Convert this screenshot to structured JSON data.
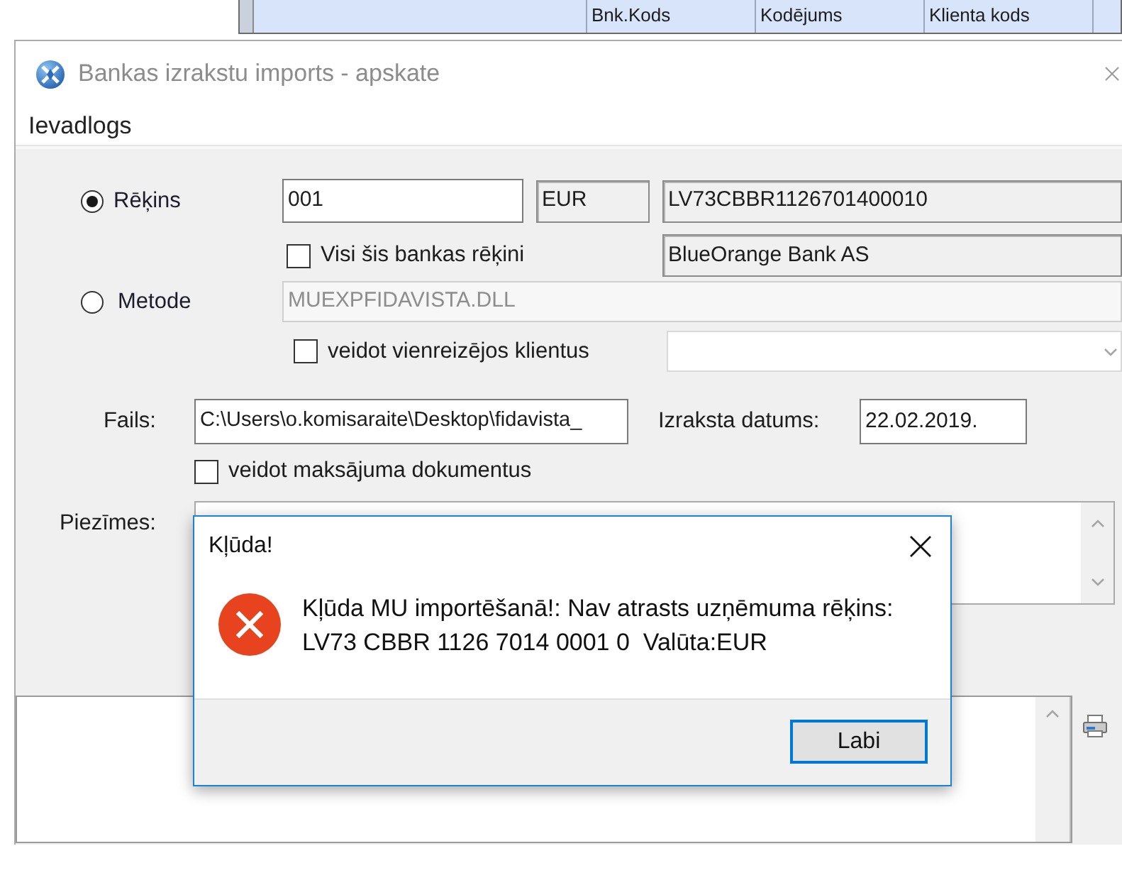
{
  "background_table": {
    "columns": [
      "Bnk.Kods",
      "Kodējums",
      "Klienta kods"
    ]
  },
  "window": {
    "title": "Bankas izrakstu imports - apskate",
    "menu": [
      "Ievadlogs"
    ]
  },
  "form": {
    "source": [
      {
        "label": "Rēķins",
        "selected": true
      },
      {
        "label": "Metode",
        "selected": false
      }
    ],
    "account": "001",
    "currency": "EUR",
    "account_number": "LV73CBBR1126701400010",
    "bank": "BlueOrange Bank AS",
    "all_bank_accounts": {
      "label": "Visi šis bankas rēķini",
      "checked": false
    },
    "method": {
      "value": "MUEXPFIDAVISTA.DLL",
      "disabled": true
    },
    "one_time_clients": {
      "label": "veidot vienreizējos klientus",
      "checked": false
    },
    "file": {
      "label": "Fails:",
      "value": "C:\\Users\\o.komisaraite\\Desktop\\fidavista_"
    },
    "statement_date": {
      "label": "Izraksta datums:",
      "value": "22.02.2019."
    },
    "payment_documents": {
      "label": "veidot maksājuma dokumentus",
      "checked": false
    },
    "notes": {
      "label": "Piezīmes:"
    }
  },
  "dialog": {
    "title": "Kļūda!",
    "message": "Kļūda MU importēšanā!: Nav atrasts uzņēmuma rēķins:\nLV73 CBBR 1126 7014 0001 0  Valūta:EUR",
    "buttons": [
      {
        "label": "Labi",
        "default": true
      }
    ]
  }
}
